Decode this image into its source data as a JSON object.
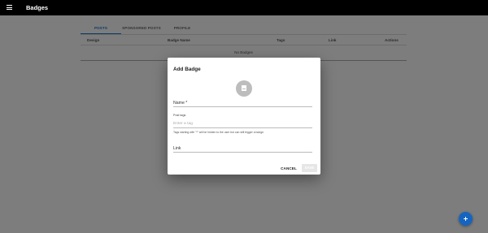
{
  "app": {
    "title": "Badges",
    "menu_icon": "menu-icon"
  },
  "tabs": [
    {
      "label": "POSTS",
      "active": true
    },
    {
      "label": "SPONSORED POSTS",
      "active": false
    },
    {
      "label": "PROFILE",
      "active": false
    }
  ],
  "table": {
    "columns": [
      "Design",
      "Badge Name",
      "Tags",
      "Link",
      "Actions"
    ],
    "empty_text": "No Badges"
  },
  "dialog": {
    "title": "Add Badge",
    "upload_icon": "document-image-icon",
    "name_label": "Name *",
    "post_tags_label": "Post tags",
    "tag_placeholder": "Enter a tag",
    "tags_helper": "Tags starting with \"*\" will be hidden to the user but can still trigger a badge.",
    "link_label": "Link",
    "cancel_label": "CANCEL",
    "save_label": "SAVE"
  },
  "fab": {
    "icon": "plus-icon"
  },
  "colors": {
    "accent": "#1976d2",
    "fab": "#1565c0",
    "appbar": "#000000"
  }
}
